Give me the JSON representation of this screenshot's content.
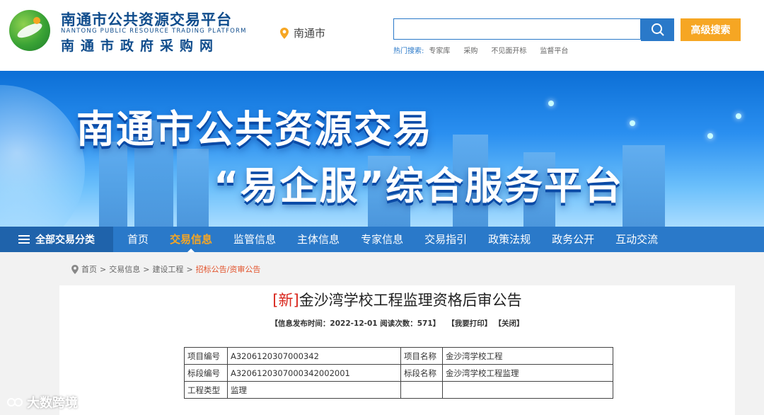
{
  "header": {
    "logo_cn": "南通市公共资源交易平台",
    "logo_en": "NANTONG PUBLIC RESOURCE TRADING PLATFORM",
    "logo_cn2": "南通市政府采购网",
    "city": "南通市",
    "search": {
      "placeholder": "",
      "value": ""
    },
    "advanced_search": "高级搜索",
    "hot_label": "热门搜索:",
    "hot_items": [
      "专家库",
      "采购",
      "不见面开标",
      "监督平台"
    ]
  },
  "banner": {
    "line1": "南通市公共资源交易",
    "line2": "“易企服”综合服务平台"
  },
  "nav": {
    "all_label": "全部交易分类",
    "items": [
      "首页",
      "交易信息",
      "监管信息",
      "主体信息",
      "专家信息",
      "交易指引",
      "政策法规",
      "政务公开",
      "互动交流"
    ],
    "active_index": 1
  },
  "breadcrumb": {
    "items": [
      "首页",
      "交易信息",
      "建设工程"
    ],
    "current": "招标公告/资审公告",
    "separator": ">"
  },
  "article": {
    "new_tag": "[新]",
    "title": "金沙湾学校工程监理资格后审公告",
    "meta_publish": "【信息发布时间：2022-12-01 阅读次数：571】",
    "print_label": "【我要打印】",
    "close_label": "【关闭】"
  },
  "info_table": {
    "rows": [
      [
        "项目编号",
        "A3206120307000342",
        "项目名称",
        "金沙湾学校工程"
      ],
      [
        "标段编号",
        "A3206120307000342002001",
        "标段名称",
        "金沙湾学校工程监理"
      ],
      [
        "工程类型",
        "监理",
        "",
        ""
      ]
    ]
  },
  "watermark": "大数跨境",
  "colors": {
    "primary": "#2a79c9",
    "accent": "#f6a623",
    "new_tag": "#d9261c"
  }
}
